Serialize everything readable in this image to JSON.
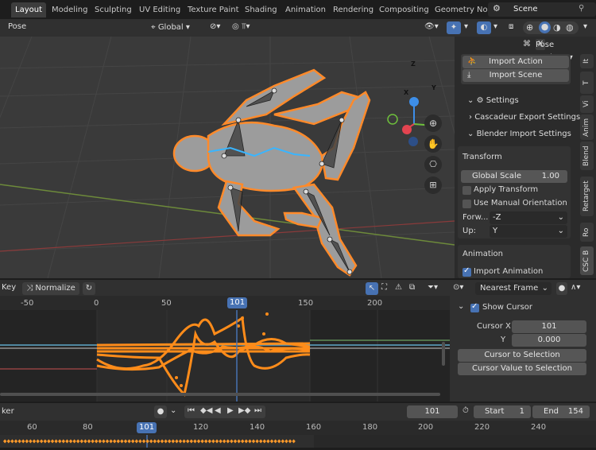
{
  "workspaces": [
    "Layout",
    "Modeling",
    "Sculpting",
    "UV Editing",
    "Texture Paint",
    "Shading",
    "Animation",
    "Rendering",
    "Compositing",
    "Geometry Noc"
  ],
  "active_workspace": "Layout",
  "scene_name": "Scene",
  "viewport_header": {
    "mode": "Pose",
    "transform_orientation": "Global",
    "pose_options": "Pose Options",
    "close": "X"
  },
  "gizmo_axes": {
    "z": "Z",
    "y": "Y",
    "x": "X"
  },
  "sidebar": {
    "import_action": "Import Action",
    "import_scene": "Import Scene",
    "settings": "Settings",
    "cascadeur_export": "Cascadeur Export Settings",
    "blender_import": "Blender Import Settings",
    "transform": "Transform",
    "global_scale_label": "Global Scale",
    "global_scale_value": "1.00",
    "apply_transform": "Apply Transform",
    "use_manual_orientation": "Use Manual Orientation",
    "forward_label": "Forw...",
    "forward_value": "-Z",
    "up_label": "Up:",
    "up_value": "Y",
    "animation": "Animation",
    "import_animation": "Import Animation",
    "tabs": [
      "It",
      "T",
      "Vi",
      "Anim",
      "Blend",
      "Retarget",
      "Ro",
      "CSC B"
    ]
  },
  "graph_editor": {
    "key_menu": "Key",
    "normalize": "Normalize",
    "snap_mode": "Nearest Frame",
    "ruler": [
      "-50",
      "0",
      "50",
      "150",
      "200"
    ],
    "current_frame": "101",
    "show_cursor": "Show Cursor",
    "cursor_x_label": "Cursor X",
    "cursor_x_value": "101",
    "cursor_y_label": "Y",
    "cursor_y_value": "0.000",
    "cursor_to_selection": "Cursor to Selection",
    "cursor_value_to_selection": "Cursor Value to Selection"
  },
  "timeline": {
    "markers_label": "ker",
    "current_frame": "101",
    "start_label": "Start",
    "start_value": "1",
    "end_label": "End",
    "end_value": "154",
    "ruler": [
      "60",
      "80",
      "120",
      "140",
      "160",
      "180",
      "200",
      "220",
      "240"
    ]
  },
  "colors": {
    "accent": "#4772b3",
    "curve": "#ff8c1a",
    "axis_x": "#e34450",
    "axis_y": "#6ebf3c",
    "axis_z": "#3d8ee8"
  }
}
